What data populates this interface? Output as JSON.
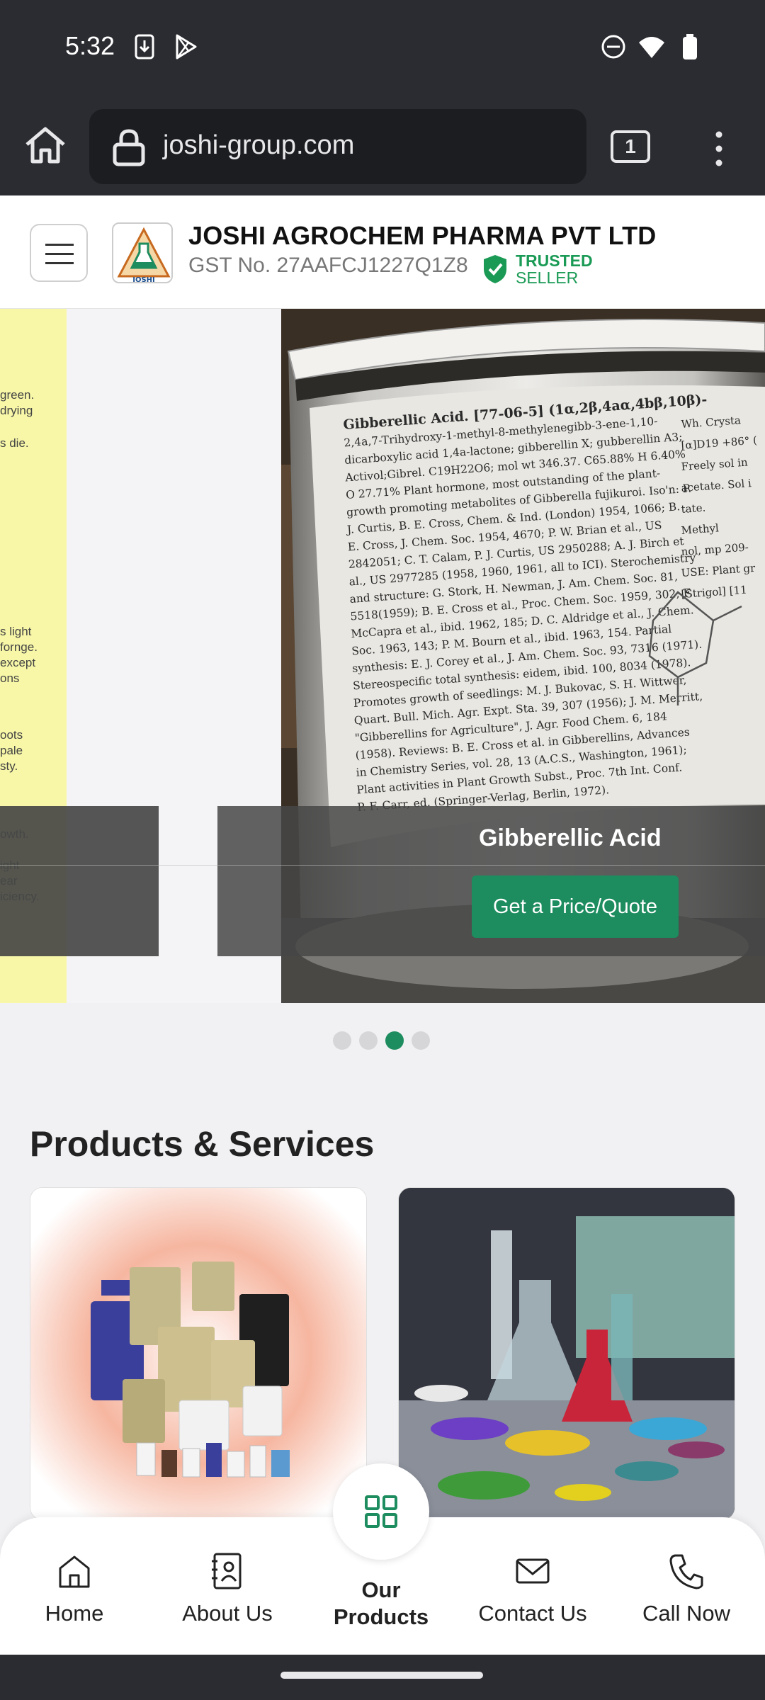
{
  "status_bar": {
    "time": "5:32",
    "icons": [
      "download-icon",
      "play-store-icon",
      "dnd-icon",
      "wifi-icon",
      "battery-icon"
    ]
  },
  "browser": {
    "url": "joshi-group.com",
    "tab_count": "1"
  },
  "header": {
    "company_name": "JOSHI AGROCHEM PHARMA PVT LTD",
    "gst": "GST No. 27AAFCJ1227Q1Z8",
    "trusted_line1": "TRUSTED",
    "trusted_line2": "SELLER",
    "logo_text": "JOSHI"
  },
  "carousel": {
    "slide_title": "Gibberellic Acid",
    "cta_label": "Get a Price/Quote",
    "active_index": 2,
    "slide_count": 4,
    "left_slide_lines": [
      "green.",
      "drying",
      "s die.",
      "s light",
      "fornge.",
      "except",
      "ons",
      "oots",
      "pale",
      "sty.",
      "owth.",
      "ight",
      "ear",
      "iciency."
    ],
    "label_lines": [
      "Gibberellic Acid. [77-06-5] (1α,2β,4aα,4bβ,10β)-",
      "2,4a,7-Trihydroxy-1-methyl-8-methylenegibb-3-ene-1,10-",
      "dicarboxylic acid 1,4a-lactone; gibberellin X; gubberellin A3;",
      "Activol;Gibrel. C19H22O6; mol wt 346.37. C65.88% H 6.40%",
      "O 27.71% Plant hormone, most outstanding of the plant-",
      "growth promoting metabolites of Gibberella fujikuroi. Iso'n: P.",
      "J. Curtis, B. E. Cross, Chem. & Ind. (London) 1954, 1066; B.",
      "E. Cross, J. Chem. Soc. 1954, 4670; P. W. Brian et al., US",
      "2842051; C. T. Calam, P. J. Curtis, US 2950288; A. J. Birch et",
      "al., US 2977285 (1958, 1960, 1961, all to ICI). Sterochemistry",
      "and structure: G. Stork, H. Newman, J. Am. Chem. Soc. 81,",
      "5518(1959); B. E. Cross et al., Proc. Chem. Soc. 1959, 302; F.",
      "McCapra et al., ibid. 1962, 185; D. C. Aldridge et al., J. Chem.",
      "Soc. 1963, 143; P. M. Bourn et al., ibid. 1963, 154. Partial",
      "synthesis: E. J. Corey et al., J. Am. Chem. Soc. 93, 7316 (1971).",
      "Stereospecific total synthesis: eidem, ibid. 100, 8034 (1978).",
      "Promotes growth of seedlings: M. J. Bukovac, S. H. Wittwer,",
      "Quart. Bull. Mich. Agr. Expt. Sta. 39, 307 (1956); J. M. Merritt,",
      "\"Gibberellins for Agriculture\", J. Agr. Food Chem. 6, 184",
      "(1958). Reviews: B. E. Cross et al. in Gibberellins, Advances",
      "in Chemistry Series, vol. 28, 13 (A.C.S., Washington, 1961);",
      "Plant activities in Plant Growth Subst., Proc. 7th Int. Conf.",
      "P. F. Carr, ed. (Springer-Verlag, Berlin, 1972)."
    ],
    "label_side_lines": [
      "Wh. Crysta",
      "[α]D19 +86° (",
      "Freely sol in",
      "acetate. Sol i",
      "tate.",
      "Methyl",
      "nol, mp 209-",
      "USE: Plant gr",
      "[Strigol] [11"
    ]
  },
  "products": {
    "section_title": "Products & Services"
  },
  "bottom_nav": {
    "home": "Home",
    "about": "About Us",
    "products_line1": "Our",
    "products_line2": "Products",
    "contact": "Contact Us",
    "call": "Call Now"
  },
  "colors": {
    "accent": "#1d8c5e",
    "trusted": "#1a9a55",
    "chrome": "#2b2c31"
  }
}
